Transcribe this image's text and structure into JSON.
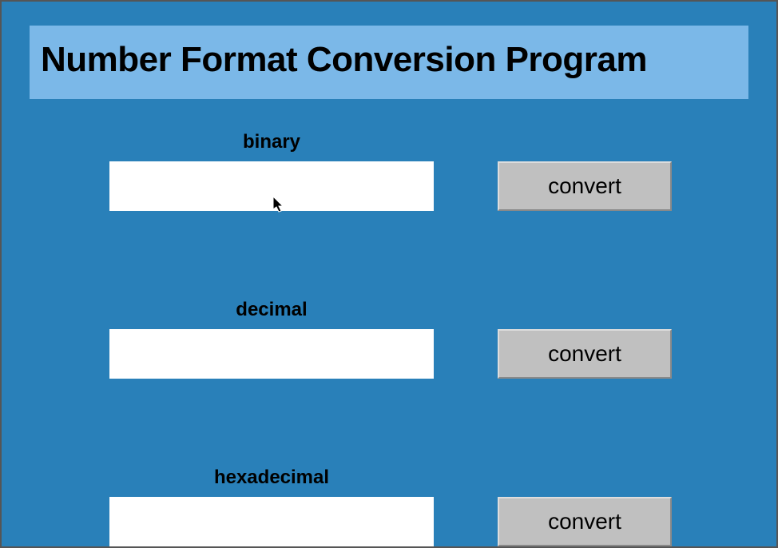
{
  "title": "Number Format Conversion Program",
  "rows": [
    {
      "label": "binary",
      "value": "",
      "button": "convert"
    },
    {
      "label": "decimal",
      "value": "",
      "button": "convert"
    },
    {
      "label": "hexadecimal",
      "value": "",
      "button": "convert"
    }
  ],
  "colors": {
    "background": "#2980b9",
    "titleBar": "#7bb8e8",
    "button": "#c0c0c0"
  }
}
